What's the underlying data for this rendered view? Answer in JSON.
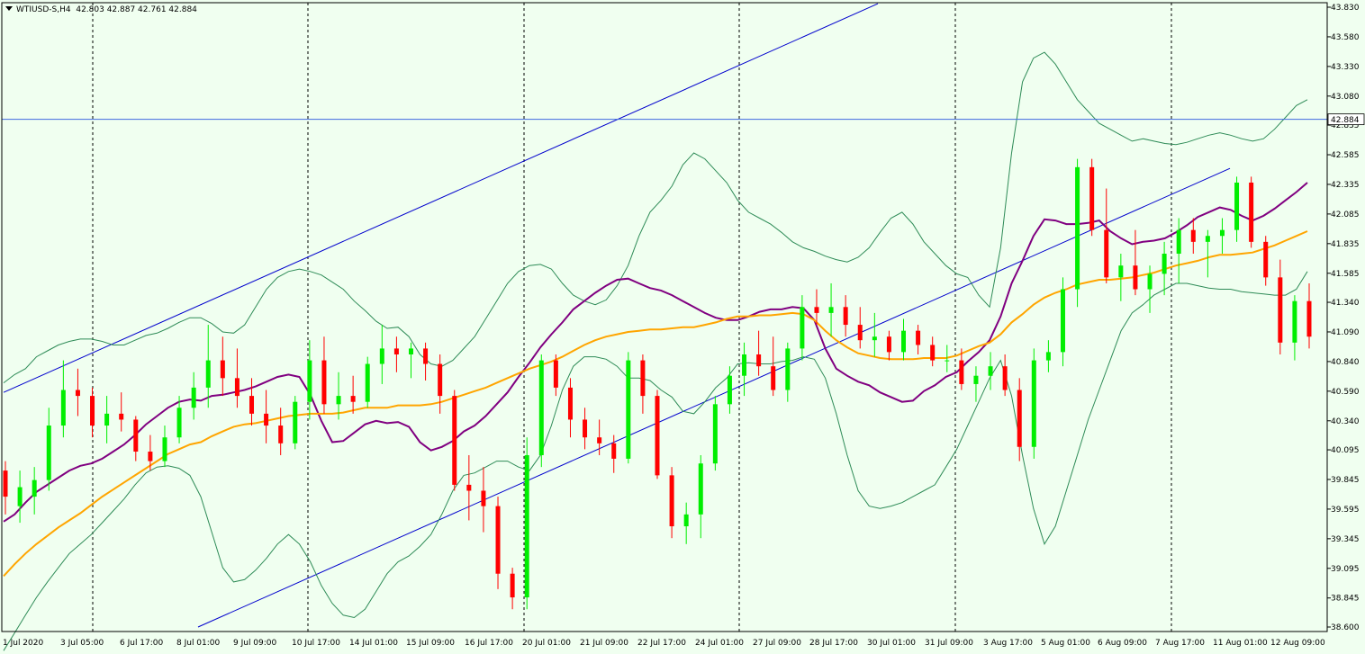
{
  "header": {
    "symbol": "WTIUSD-S,H4",
    "ohlc": "42.803 42.887 42.761 42.884"
  },
  "price_label": "42.884",
  "chart_data": {
    "type": "candlestick",
    "title": "WTIUSD-S,H4",
    "y_ticks": [
      "43.830",
      "43.580",
      "43.330",
      "43.080",
      "42.835",
      "42.585",
      "42.335",
      "42.085",
      "41.835",
      "41.585",
      "41.340",
      "41.090",
      "40.840",
      "40.590",
      "40.340",
      "40.095",
      "39.845",
      "39.595",
      "39.345",
      "39.095",
      "38.845",
      "38.600"
    ],
    "ylim": [
      38.6,
      43.83
    ],
    "x_ticks": [
      "1 Jul 2020",
      "3 Jul 05:00",
      "6 Jul 17:00",
      "8 Jul 01:00",
      "9 Jul 09:00",
      "10 Jul 17:00",
      "14 Jul 01:00",
      "15 Jul 09:00",
      "16 Jul 17:00",
      "20 Jul 01:00",
      "21 Jul 09:00",
      "22 Jul 17:00",
      "24 Jul 01:00",
      "27 Jul 09:00",
      "28 Jul 17:00",
      "30 Jul 01:00",
      "31 Jul 09:00",
      "3 Aug 17:00",
      "5 Aug 01:00",
      "6 Aug 09:00",
      "7 Aug 17:00",
      "11 Aug 01:00",
      "12 Aug 09:00"
    ],
    "current_price": 42.884,
    "colors": {
      "background": "#f0fff0",
      "bull": "#00ee00",
      "bear": "#ff0000",
      "ma_fast": "#800080",
      "ma_slow": "#ffa500",
      "bollinger": "#2e8b57",
      "channel": "#0000cd",
      "price_line": "#4169e1"
    },
    "series": [
      {
        "name": "MA fast",
        "values": [
          39.49,
          39.55,
          39.65,
          39.74,
          39.8,
          39.86,
          39.92,
          39.96,
          39.98,
          40.02,
          40.08,
          40.14,
          40.22,
          40.31,
          40.38,
          40.45,
          40.5,
          40.52,
          40.51,
          40.55,
          40.56,
          40.58,
          40.6,
          40.63,
          40.67,
          40.71,
          40.73,
          40.71,
          40.56,
          40.34,
          40.16,
          40.17,
          40.24,
          40.31,
          40.34,
          40.32,
          40.33,
          40.29,
          40.16,
          40.09,
          40.12,
          40.17,
          40.25,
          40.3,
          40.38,
          40.48,
          40.58,
          40.71,
          40.83,
          40.96,
          41.07,
          41.17,
          41.28,
          41.35,
          41.42,
          41.48,
          41.53,
          41.54,
          41.5,
          41.46,
          41.44,
          41.4,
          41.35,
          41.3,
          41.25,
          41.21,
          41.19,
          41.19,
          41.22,
          41.26,
          41.28,
          41.28,
          41.3,
          41.29,
          41.19,
          40.95,
          40.78,
          40.72,
          40.67,
          40.64,
          40.58,
          40.54,
          40.5,
          40.51,
          40.59,
          40.64,
          40.71,
          40.75,
          40.84,
          40.92,
          41.02,
          41.22,
          41.5,
          41.69,
          41.9,
          42.04,
          42.03,
          42.0,
          42.0,
          42.01,
          42.03,
          41.94,
          41.88,
          41.83,
          41.85,
          41.86,
          41.88,
          41.93,
          41.99,
          42.06,
          42.1,
          42.14,
          42.12,
          42.07,
          42.03,
          42.07,
          42.13,
          42.2,
          42.27,
          42.35
        ]
      },
      {
        "name": "MA slow",
        "values": [
          39.03,
          39.13,
          39.22,
          39.3,
          39.37,
          39.44,
          39.5,
          39.56,
          39.63,
          39.7,
          39.76,
          39.82,
          39.88,
          39.94,
          40.0,
          40.06,
          40.1,
          40.14,
          40.16,
          40.21,
          40.25,
          40.29,
          40.31,
          40.32,
          40.34,
          40.36,
          40.38,
          40.39,
          40.4,
          40.4,
          40.4,
          40.41,
          40.43,
          40.45,
          40.45,
          40.45,
          40.47,
          40.47,
          40.47,
          40.48,
          40.5,
          40.53,
          40.56,
          40.59,
          40.62,
          40.66,
          40.7,
          40.74,
          40.78,
          40.81,
          40.84,
          40.88,
          40.93,
          40.98,
          41.02,
          41.05,
          41.07,
          41.09,
          41.1,
          41.11,
          41.11,
          41.12,
          41.13,
          41.13,
          41.15,
          41.17,
          41.2,
          41.22,
          41.22,
          41.23,
          41.23,
          41.24,
          41.25,
          41.24,
          41.19,
          41.1,
          41.02,
          40.96,
          40.91,
          40.89,
          40.87,
          40.86,
          40.86,
          40.86,
          40.87,
          40.87,
          40.87,
          40.89,
          40.93,
          40.97,
          41.0,
          41.07,
          41.17,
          41.24,
          41.32,
          41.38,
          41.42,
          41.45,
          41.49,
          41.51,
          41.53,
          41.53,
          41.54,
          41.55,
          41.57,
          41.59,
          41.62,
          41.65,
          41.67,
          41.69,
          41.72,
          41.74,
          41.74,
          41.75,
          41.76,
          41.79,
          41.82,
          41.86,
          41.9,
          41.94
        ]
      },
      {
        "name": "BB upper",
        "values": [
          40.66,
          40.73,
          40.78,
          40.88,
          40.93,
          40.98,
          41.01,
          41.03,
          41.03,
          41.01,
          40.98,
          40.98,
          41.02,
          41.06,
          41.08,
          41.12,
          41.17,
          41.21,
          41.21,
          41.16,
          41.09,
          41.08,
          41.15,
          41.3,
          41.45,
          41.55,
          41.6,
          41.62,
          41.6,
          41.57,
          41.51,
          41.45,
          41.35,
          41.27,
          41.18,
          41.12,
          41.13,
          41.05,
          40.9,
          40.82,
          40.8,
          40.85,
          40.95,
          41.05,
          41.2,
          41.35,
          41.5,
          41.6,
          41.65,
          41.66,
          41.62,
          41.5,
          41.4,
          41.35,
          41.32,
          41.36,
          41.48,
          41.65,
          41.9,
          42.1,
          42.2,
          42.32,
          42.5,
          42.6,
          42.55,
          42.45,
          42.35,
          42.2,
          42.1,
          42.05,
          42.0,
          41.93,
          41.85,
          41.8,
          41.77,
          41.73,
          41.7,
          41.68,
          41.72,
          41.8,
          41.93,
          42.05,
          42.1,
          42.0,
          41.85,
          41.75,
          41.65,
          41.58,
          41.55,
          41.4,
          41.3,
          41.8,
          42.6,
          43.2,
          43.4,
          43.45,
          43.35,
          43.2,
          43.05,
          42.95,
          42.85,
          42.8,
          42.75,
          42.7,
          42.72,
          42.7,
          42.68,
          42.67,
          42.69,
          42.72,
          42.75,
          42.77,
          42.75,
          42.72,
          42.7,
          42.72,
          42.8,
          42.9,
          43.0,
          43.05
        ]
      },
      {
        "name": "BB lower",
        "values": [
          38.4,
          38.55,
          38.7,
          38.85,
          38.98,
          39.1,
          39.22,
          39.3,
          39.38,
          39.48,
          39.58,
          39.68,
          39.8,
          39.9,
          39.95,
          39.96,
          39.94,
          39.88,
          39.7,
          39.4,
          39.1,
          38.98,
          39.0,
          39.08,
          39.18,
          39.3,
          39.38,
          39.3,
          39.15,
          38.95,
          38.8,
          38.7,
          38.68,
          38.75,
          38.9,
          39.05,
          39.15,
          39.2,
          39.28,
          39.38,
          39.55,
          39.75,
          39.88,
          39.9,
          39.95,
          40.0,
          40.0,
          39.95,
          39.92,
          40.05,
          40.3,
          40.6,
          40.8,
          40.88,
          40.88,
          40.86,
          40.8,
          40.7,
          40.7,
          40.68,
          40.6,
          40.54,
          40.42,
          40.4,
          40.5,
          40.62,
          40.7,
          40.82,
          40.83,
          40.82,
          40.82,
          40.84,
          40.85,
          40.88,
          40.86,
          40.7,
          40.4,
          40.05,
          39.75,
          39.62,
          39.6,
          39.62,
          39.65,
          39.7,
          39.75,
          39.8,
          39.95,
          40.1,
          40.3,
          40.5,
          40.7,
          40.85,
          40.55,
          40.05,
          39.6,
          39.3,
          39.45,
          39.75,
          40.05,
          40.35,
          40.6,
          40.85,
          41.1,
          41.25,
          41.32,
          41.4,
          41.45,
          41.5,
          41.5,
          41.48,
          41.46,
          41.45,
          41.45,
          41.43,
          41.42,
          41.41,
          41.4,
          41.4,
          41.45,
          41.6
        ]
      }
    ],
    "candles": [
      {
        "o": 39.92,
        "h": 40.0,
        "l": 39.55,
        "c": 39.7
      },
      {
        "o": 39.62,
        "h": 39.92,
        "l": 39.48,
        "c": 39.78
      },
      {
        "o": 39.7,
        "h": 39.95,
        "l": 39.55,
        "c": 39.84
      },
      {
        "o": 39.84,
        "h": 40.45,
        "l": 39.75,
        "c": 40.3
      },
      {
        "o": 40.3,
        "h": 40.85,
        "l": 40.2,
        "c": 40.6
      },
      {
        "o": 40.6,
        "h": 40.78,
        "l": 40.38,
        "c": 40.55
      },
      {
        "o": 40.55,
        "h": 40.62,
        "l": 40.2,
        "c": 40.3
      },
      {
        "o": 40.3,
        "h": 40.55,
        "l": 40.15,
        "c": 40.4
      },
      {
        "o": 40.4,
        "h": 40.58,
        "l": 40.25,
        "c": 40.35
      },
      {
        "o": 40.35,
        "h": 40.38,
        "l": 40.0,
        "c": 40.08
      },
      {
        "o": 40.08,
        "h": 40.22,
        "l": 39.92,
        "c": 40.0
      },
      {
        "o": 40.0,
        "h": 40.3,
        "l": 39.95,
        "c": 40.2
      },
      {
        "o": 40.2,
        "h": 40.55,
        "l": 40.15,
        "c": 40.45
      },
      {
        "o": 40.45,
        "h": 40.75,
        "l": 40.35,
        "c": 40.62
      },
      {
        "o": 40.62,
        "h": 41.15,
        "l": 40.45,
        "c": 40.85
      },
      {
        "o": 40.85,
        "h": 41.05,
        "l": 40.55,
        "c": 40.7
      },
      {
        "o": 40.7,
        "h": 40.95,
        "l": 40.45,
        "c": 40.55
      },
      {
        "o": 40.55,
        "h": 40.7,
        "l": 40.3,
        "c": 40.4
      },
      {
        "o": 40.4,
        "h": 40.6,
        "l": 40.15,
        "c": 40.3
      },
      {
        "o": 40.3,
        "h": 40.45,
        "l": 40.05,
        "c": 40.15
      },
      {
        "o": 40.15,
        "h": 40.55,
        "l": 40.1,
        "c": 40.5
      },
      {
        "o": 40.5,
        "h": 41.02,
        "l": 40.35,
        "c": 40.85
      },
      {
        "o": 40.85,
        "h": 41.05,
        "l": 40.4,
        "c": 40.48
      },
      {
        "o": 40.48,
        "h": 40.75,
        "l": 40.35,
        "c": 40.55
      },
      {
        "o": 40.55,
        "h": 40.72,
        "l": 40.4,
        "c": 40.5
      },
      {
        "o": 40.5,
        "h": 40.88,
        "l": 40.45,
        "c": 40.82
      },
      {
        "o": 40.82,
        "h": 41.15,
        "l": 40.65,
        "c": 40.95
      },
      {
        "o": 40.95,
        "h": 41.05,
        "l": 40.75,
        "c": 40.9
      },
      {
        "o": 40.9,
        "h": 41.0,
        "l": 40.7,
        "c": 40.95
      },
      {
        "o": 40.95,
        "h": 41.0,
        "l": 40.68,
        "c": 40.82
      },
      {
        "o": 40.82,
        "h": 40.9,
        "l": 40.4,
        "c": 40.55
      },
      {
        "o": 40.55,
        "h": 40.6,
        "l": 39.75,
        "c": 39.8
      },
      {
        "o": 39.8,
        "h": 40.05,
        "l": 39.5,
        "c": 39.75
      },
      {
        "o": 39.75,
        "h": 39.95,
        "l": 39.4,
        "c": 39.62
      },
      {
        "o": 39.62,
        "h": 39.7,
        "l": 38.92,
        "c": 39.05
      },
      {
        "o": 39.05,
        "h": 39.1,
        "l": 38.75,
        "c": 38.85
      },
      {
        "o": 38.85,
        "h": 40.2,
        "l": 38.75,
        "c": 40.05
      },
      {
        "o": 40.05,
        "h": 40.9,
        "l": 39.95,
        "c": 40.85
      },
      {
        "o": 40.85,
        "h": 40.9,
        "l": 40.55,
        "c": 40.62
      },
      {
        "o": 40.62,
        "h": 40.7,
        "l": 40.2,
        "c": 40.35
      },
      {
        "o": 40.35,
        "h": 40.45,
        "l": 40.1,
        "c": 40.2
      },
      {
        "o": 40.2,
        "h": 40.35,
        "l": 40.05,
        "c": 40.15
      },
      {
        "o": 40.15,
        "h": 40.22,
        "l": 39.9,
        "c": 40.02
      },
      {
        "o": 40.02,
        "h": 40.92,
        "l": 39.98,
        "c": 40.85
      },
      {
        "o": 40.85,
        "h": 40.9,
        "l": 40.4,
        "c": 40.55
      },
      {
        "o": 40.55,
        "h": 40.6,
        "l": 39.85,
        "c": 39.88
      },
      {
        "o": 39.88,
        "h": 39.95,
        "l": 39.35,
        "c": 39.45
      },
      {
        "o": 39.45,
        "h": 39.65,
        "l": 39.3,
        "c": 39.55
      },
      {
        "o": 39.55,
        "h": 40.05,
        "l": 39.35,
        "c": 39.98
      },
      {
        "o": 39.98,
        "h": 40.55,
        "l": 39.92,
        "c": 40.48
      },
      {
        "o": 40.48,
        "h": 40.8,
        "l": 40.4,
        "c": 40.72
      },
      {
        "o": 40.72,
        "h": 41.0,
        "l": 40.55,
        "c": 40.9
      },
      {
        "o": 40.9,
        "h": 41.1,
        "l": 40.72,
        "c": 40.8
      },
      {
        "o": 40.8,
        "h": 41.05,
        "l": 40.55,
        "c": 40.6
      },
      {
        "o": 40.6,
        "h": 41.0,
        "l": 40.5,
        "c": 40.95
      },
      {
        "o": 40.95,
        "h": 41.4,
        "l": 40.85,
        "c": 41.3
      },
      {
        "o": 41.3,
        "h": 41.45,
        "l": 41.15,
        "c": 41.25
      },
      {
        "o": 41.25,
        "h": 41.5,
        "l": 41.05,
        "c": 41.3
      },
      {
        "o": 41.3,
        "h": 41.4,
        "l": 41.05,
        "c": 41.15
      },
      {
        "o": 41.15,
        "h": 41.3,
        "l": 40.95,
        "c": 41.02
      },
      {
        "o": 41.02,
        "h": 41.25,
        "l": 40.88,
        "c": 41.05
      },
      {
        "o": 41.05,
        "h": 41.1,
        "l": 40.85,
        "c": 40.92
      },
      {
        "o": 40.92,
        "h": 41.2,
        "l": 40.85,
        "c": 41.1
      },
      {
        "o": 41.1,
        "h": 41.15,
        "l": 40.9,
        "c": 40.98
      },
      {
        "o": 40.98,
        "h": 41.05,
        "l": 40.8,
        "c": 40.85
      },
      {
        "o": 40.85,
        "h": 40.98,
        "l": 40.75,
        "c": 40.85
      },
      {
        "o": 40.85,
        "h": 40.95,
        "l": 40.6,
        "c": 40.65
      },
      {
        "o": 40.65,
        "h": 40.8,
        "l": 40.5,
        "c": 40.72
      },
      {
        "o": 40.72,
        "h": 40.92,
        "l": 40.6,
        "c": 40.8
      },
      {
        "o": 40.8,
        "h": 40.9,
        "l": 40.55,
        "c": 40.6
      },
      {
        "o": 40.6,
        "h": 40.7,
        "l": 40.0,
        "c": 40.12
      },
      {
        "o": 40.12,
        "h": 40.95,
        "l": 40.02,
        "c": 40.85
      },
      {
        "o": 40.85,
        "h": 41.02,
        "l": 40.75,
        "c": 40.92
      },
      {
        "o": 40.92,
        "h": 41.55,
        "l": 40.8,
        "c": 41.45
      },
      {
        "o": 41.45,
        "h": 42.55,
        "l": 41.3,
        "c": 42.48
      },
      {
        "o": 42.48,
        "h": 42.55,
        "l": 41.9,
        "c": 41.95
      },
      {
        "o": 41.95,
        "h": 42.3,
        "l": 41.5,
        "c": 41.55
      },
      {
        "o": 41.55,
        "h": 41.75,
        "l": 41.35,
        "c": 41.65
      },
      {
        "o": 41.65,
        "h": 41.95,
        "l": 41.4,
        "c": 41.45
      },
      {
        "o": 41.45,
        "h": 41.65,
        "l": 41.25,
        "c": 41.58
      },
      {
        "o": 41.58,
        "h": 41.85,
        "l": 41.4,
        "c": 41.75
      },
      {
        "o": 41.75,
        "h": 42.05,
        "l": 41.5,
        "c": 41.95
      },
      {
        "o": 41.95,
        "h": 42.05,
        "l": 41.75,
        "c": 41.85
      },
      {
        "o": 41.85,
        "h": 41.95,
        "l": 41.55,
        "c": 41.9
      },
      {
        "o": 41.9,
        "h": 42.05,
        "l": 41.75,
        "c": 41.95
      },
      {
        "o": 41.95,
        "h": 42.4,
        "l": 41.85,
        "c": 42.35
      },
      {
        "o": 42.35,
        "h": 42.4,
        "l": 41.8,
        "c": 41.85
      },
      {
        "o": 41.85,
        "h": 41.9,
        "l": 41.48,
        "c": 41.55
      },
      {
        "o": 41.55,
        "h": 41.7,
        "l": 40.9,
        "c": 41.0
      },
      {
        "o": 41.0,
        "h": 41.4,
        "l": 40.85,
        "c": 41.35
      },
      {
        "o": 41.35,
        "h": 41.5,
        "l": 40.95,
        "c": 41.05
      }
    ]
  }
}
